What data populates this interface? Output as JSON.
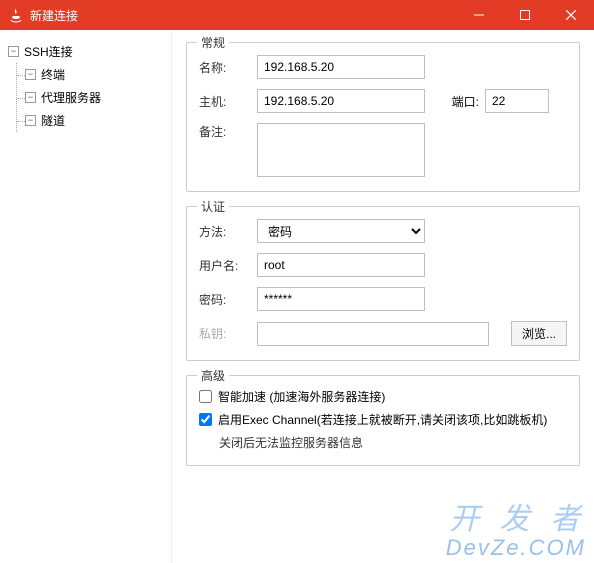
{
  "window": {
    "title": "新建连接"
  },
  "tree": {
    "root": "SSH连接",
    "items": [
      "终端",
      "代理服务器",
      "隧道"
    ]
  },
  "general": {
    "legend": "常规",
    "name_label": "名称:",
    "name_value": "192.168.5.20",
    "host_label": "主机:",
    "host_value": "192.168.5.20",
    "port_label": "端口:",
    "port_value": "22",
    "remark_label": "备注:",
    "remark_value": ""
  },
  "auth": {
    "legend": "认证",
    "method_label": "方法:",
    "method_value": "密码",
    "user_label": "用户名:",
    "user_value": "root",
    "pass_label": "密码:",
    "pass_value": "******",
    "key_label": "私钥:",
    "key_value": "",
    "browse": "浏览..."
  },
  "advanced": {
    "legend": "高级",
    "smart_accel": "智能加速 (加速海外服务器连接)",
    "exec_channel": "启用Exec Channel(若连接上就被断开,请关闭该项,比如跳板机)",
    "exec_note": "关闭后无法监控服务器信息"
  },
  "watermark": {
    "l1": "开 发 者",
    "l2": "DevZe.COM"
  }
}
